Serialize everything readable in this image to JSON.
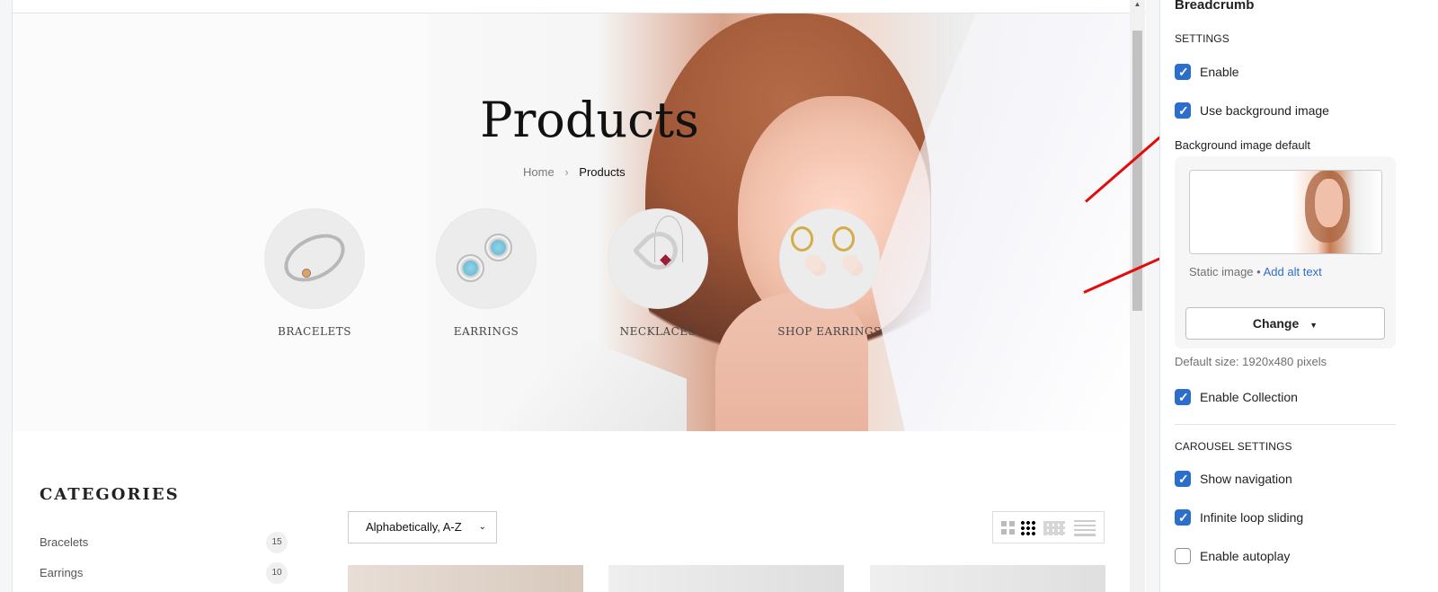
{
  "preview": {
    "hero": {
      "title": "Products",
      "breadcrumb": {
        "home": "Home",
        "separator": "›",
        "current": "Products"
      },
      "categories": [
        {
          "label": "BRACELETS",
          "icon": "bracelet-icon"
        },
        {
          "label": "EARRINGS",
          "icon": "earring-icon"
        },
        {
          "label": "NECKLACES",
          "icon": "necklace-icon"
        },
        {
          "label": "SHOP EARRINGS",
          "icon": "earring-hoop-icon"
        }
      ]
    },
    "sidebar": {
      "title": "CATEGORIES",
      "items": [
        {
          "label": "Bracelets",
          "count": "15"
        },
        {
          "label": "Earrings",
          "count": "10"
        }
      ]
    },
    "toolbar": {
      "sort": "Alphabetically, A-Z",
      "views": [
        "grid-2-icon",
        "grid-3-icon",
        "grid-4-icon",
        "list-icon"
      ]
    }
  },
  "settings_panel": {
    "title": "Breadcrumb",
    "settings_heading": "SETTINGS",
    "enable": "Enable",
    "use_background_image": "Use background image",
    "background_image_default": "Background image default",
    "static_image": "Static image",
    "bullet": "•",
    "add_alt_text": "Add alt text",
    "change": "Change",
    "default_size": "Default size: 1920x480 pixels",
    "enable_collection": "Enable Collection",
    "carousel_heading": "CAROUSEL SETTINGS",
    "show_navigation": "Show navigation",
    "infinite_loop_sliding": "Infinite loop sliding",
    "enable_autoplay": "Enable autoplay"
  },
  "colors": {
    "accent": "#2c6ecb",
    "annotation_arrow": "#e30b0b"
  }
}
